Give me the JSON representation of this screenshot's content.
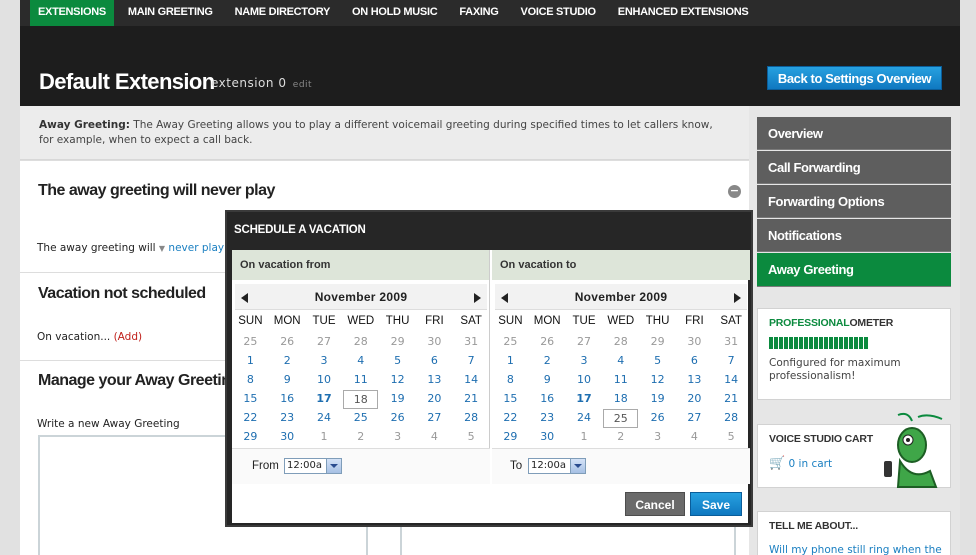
{
  "nav": {
    "tabs": [
      "EXTENSIONS",
      "MAIN GREETING",
      "NAME DIRECTORY",
      "ON HOLD MUSIC",
      "FAXING",
      "VOICE STUDIO",
      "ENHANCED EXTENSIONS"
    ]
  },
  "header": {
    "title": "Default Extension",
    "extension": "extension 0",
    "edit": "edit",
    "back_button": "Back to Settings Overview"
  },
  "description": {
    "bold": "Away Greeting:",
    "text": " The Away Greeting allows you to play a different voicemail greeting during specified times to let callers know, for example, when to expect a call back."
  },
  "sections": {
    "never_play": {
      "title": "The away greeting will never play",
      "line_prefix": "The away greeting will ",
      "link": "never play"
    },
    "vacation": {
      "title": "Vacation not scheduled",
      "line_prefix": "On vacation... ",
      "add": "(Add)"
    },
    "manage": {
      "title": "Manage your Away Greeting",
      "line": "Write a new Away Greeting"
    }
  },
  "sidebar": {
    "items": [
      "Overview",
      "Call Forwarding",
      "Forwarding Options",
      "Notifications",
      "Away Greeting"
    ],
    "professional": {
      "title_a": "PROFESSIONAL",
      "title_b": "OMETER",
      "text": "Configured for maximum professionalism!"
    },
    "cart": {
      "title": "VOICE STUDIO CART",
      "count": "0 in cart"
    },
    "tell": {
      "title": "TELL ME ABOUT...",
      "link": "Will my phone still ring when the"
    }
  },
  "modal": {
    "title": "SCHEDULE A VACATION",
    "from": {
      "header": "On vacation from",
      "month": "November 2009",
      "label": "From",
      "time": "12:00a"
    },
    "to": {
      "header": "On vacation to",
      "month": "November 2009",
      "label": "To",
      "time": "12:00a"
    },
    "weekdays": [
      "SUN",
      "MON",
      "TUE",
      "WED",
      "THU",
      "FRI",
      "SAT"
    ],
    "days": [
      [
        "25",
        "26",
        "27",
        "28",
        "29",
        "30",
        "31"
      ],
      [
        "1",
        "2",
        "3",
        "4",
        "5",
        "6",
        "7"
      ],
      [
        "8",
        "9",
        "10",
        "11",
        "12",
        "13",
        "14"
      ],
      [
        "15",
        "16",
        "17",
        "18",
        "19",
        "20",
        "21"
      ],
      [
        "22",
        "23",
        "24",
        "25",
        "26",
        "27",
        "28"
      ],
      [
        "29",
        "30",
        "1",
        "2",
        "3",
        "4",
        "5"
      ]
    ],
    "from_selected": "18",
    "to_selected": "25",
    "today": "17",
    "cancel": "Cancel",
    "save": "Save"
  },
  "colors": {
    "accent_green": "#0b8a3e",
    "button_blue": "#1a8ad0",
    "link_blue": "#1a7fc1",
    "add_red": "#c0201b"
  }
}
